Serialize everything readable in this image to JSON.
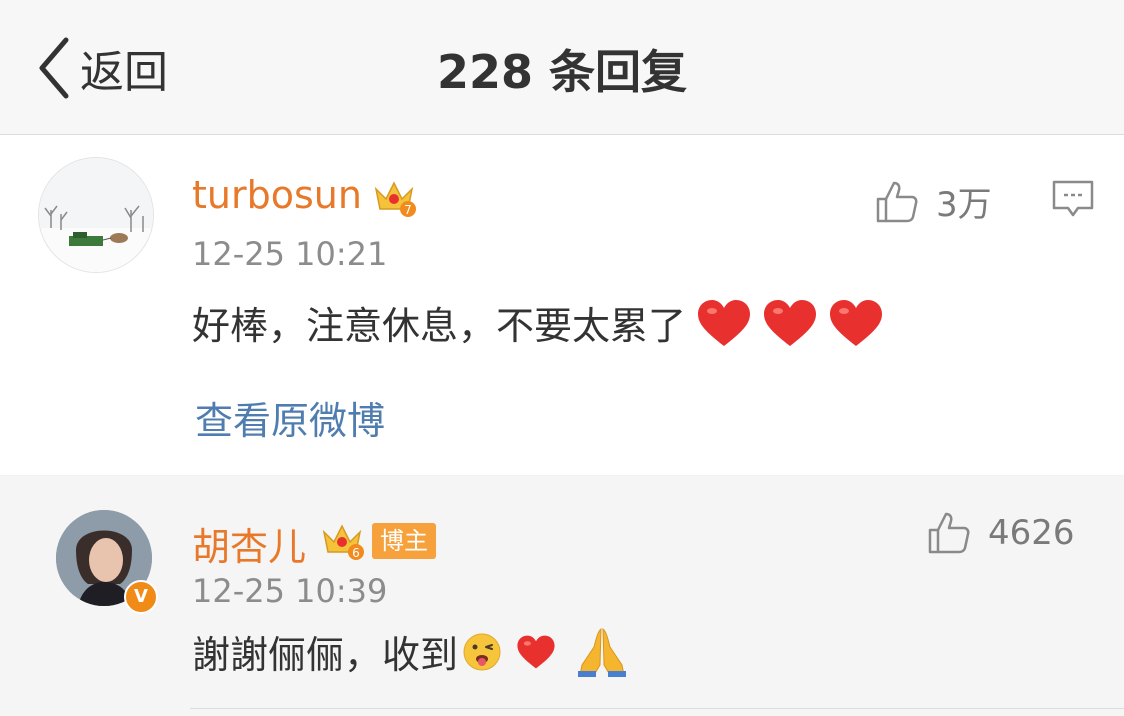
{
  "header": {
    "back_label": "返回",
    "title": "228 条回复"
  },
  "main_comment": {
    "username": "turbosun",
    "level": "7",
    "time": "12-25 10:21",
    "text": "好棒，注意休息，不要太累了",
    "emoji_icons": [
      "heart-emoji",
      "heart-emoji",
      "heart-emoji"
    ],
    "likes": "3万",
    "view_original": "查看原微博"
  },
  "reply_comment": {
    "username": "胡杏儿",
    "level": "6",
    "badge": "博主",
    "verified_mark": "V",
    "time": "12-25 10:39",
    "text": "謝謝俪俪，收到",
    "emoji_icons": [
      "tongue-wink-emoji",
      "heart-emoji",
      "pray-hands-emoji"
    ],
    "likes": "4626"
  },
  "colors": {
    "username": "#e8792a",
    "link": "#507daf",
    "heart": "#e8312f",
    "badge": "#f6a13b"
  }
}
